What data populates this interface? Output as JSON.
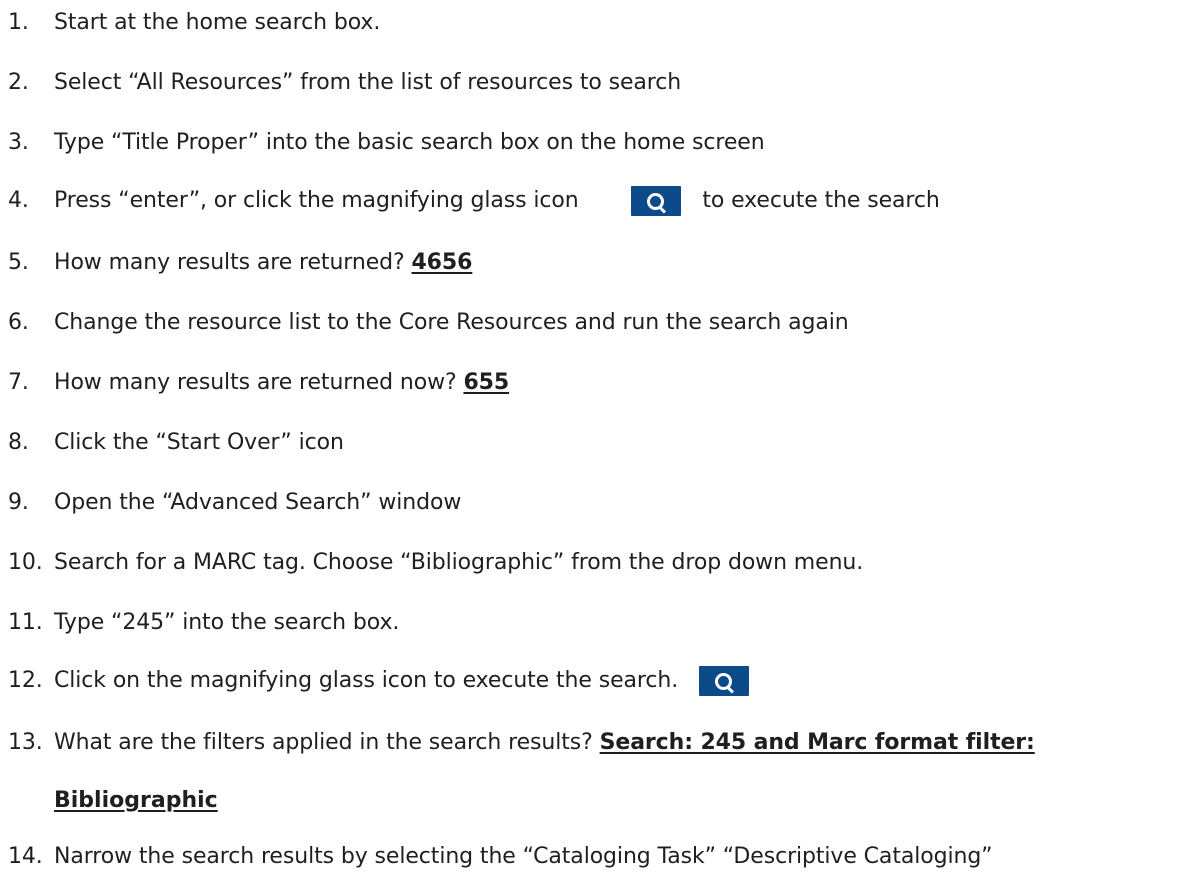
{
  "steps": [
    {
      "num": "1.",
      "text": "Start at the home search box."
    },
    {
      "num": "2.",
      "text": "Select “All Resources” from the list of resources to search"
    },
    {
      "num": "3.",
      "text": "Type “Title Proper” into the basic search box on the home screen"
    },
    {
      "num": "4.",
      "text_before": "Press “enter”, or click the magnifying glass icon",
      "icon": "magnifying-glass-icon",
      "text_after": "to execute the search"
    },
    {
      "num": "5.",
      "text": "How many results are returned? ",
      "answer": "4656"
    },
    {
      "num": "6.",
      "text": "Change the resource list to the Core Resources and run the search again"
    },
    {
      "num": "7.",
      "text": "How many results are returned now? ",
      "answer": "655"
    },
    {
      "num": "8.",
      "text": "Click the “Start Over” icon"
    },
    {
      "num": "9.",
      "text": "Open the “Advanced Search” window"
    },
    {
      "num": "10.",
      "text": "Search for a MARC tag. Choose “Bibliographic” from the drop down menu."
    },
    {
      "num": "11.",
      "text": "Type “245” into the search box."
    },
    {
      "num": "12.",
      "text": "Click on the magnifying glass icon to execute the search.",
      "icon": "magnifying-glass-icon"
    },
    {
      "num": "13.",
      "text": "What are the filters applied in the search results? ",
      "answer": "Search: 245 and Marc format filter:",
      "answer_cont": "Bibliographic"
    },
    {
      "num": "14.",
      "text": "Narrow the search results by selecting the “Cataloging Task” “Descriptive Cataloging”"
    }
  ],
  "colors": {
    "icon_bg": "#0d4a8a",
    "icon_fg": "#ffffff",
    "text": "#1f1f1f"
  }
}
